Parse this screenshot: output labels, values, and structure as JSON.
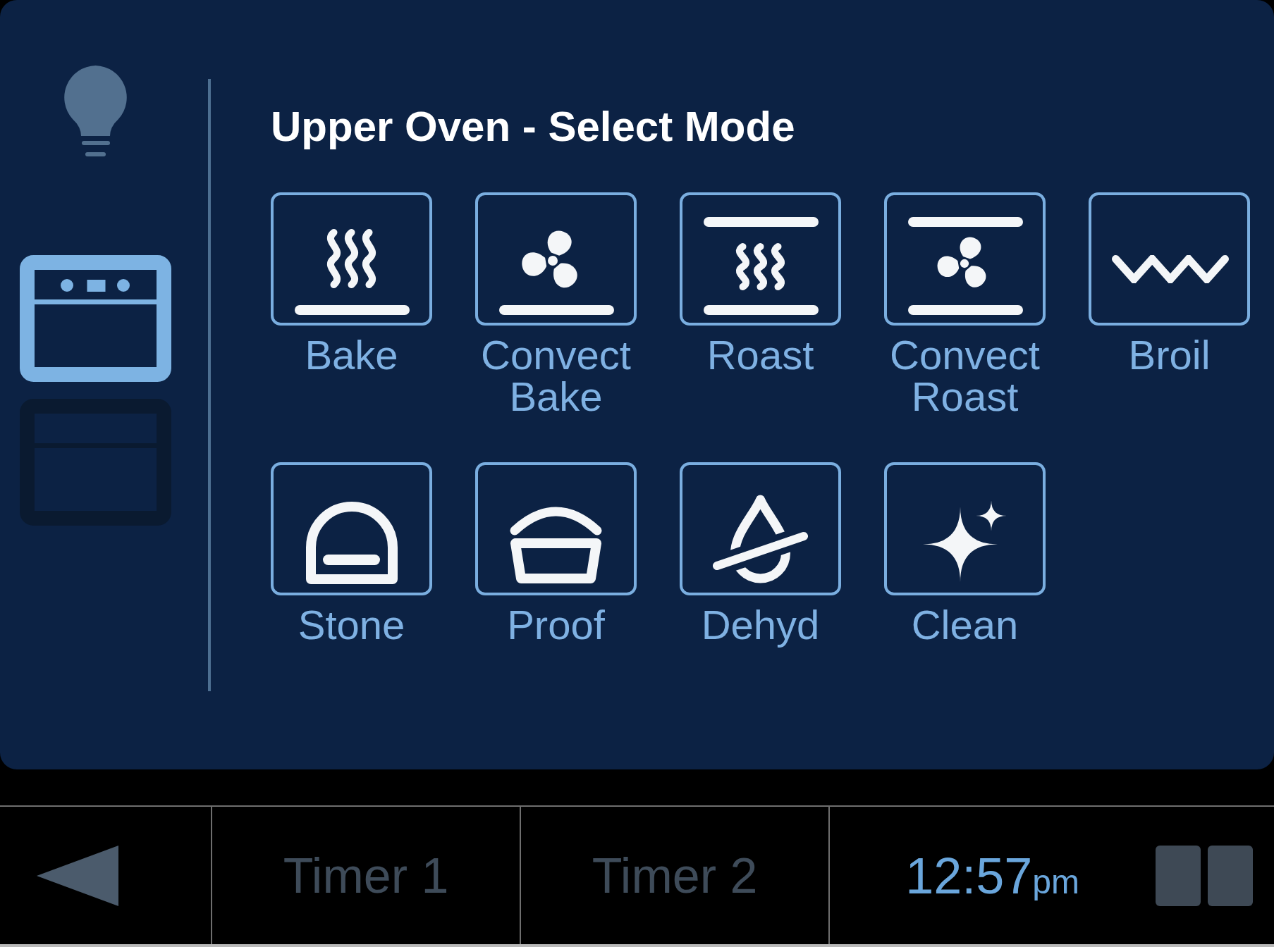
{
  "sidebar": {
    "ovens": [
      {
        "kind": "upper",
        "selected": true
      },
      {
        "kind": "lower",
        "selected": false
      }
    ]
  },
  "title": "Upper Oven - Select Mode",
  "modes": [
    {
      "label": "Bake",
      "kind": "bake"
    },
    {
      "label": "Convect Bake",
      "kind": "convect_bake"
    },
    {
      "label": "Roast",
      "kind": "roast"
    },
    {
      "label": "Convect Roast",
      "kind": "convect_roast"
    },
    {
      "label": "Broil",
      "kind": "broil"
    },
    {
      "label": "Stone",
      "kind": "stone"
    },
    {
      "label": "Proof",
      "kind": "proof"
    },
    {
      "label": "Dehyd",
      "kind": "dehyd"
    },
    {
      "label": "Clean",
      "kind": "clean"
    }
  ],
  "bottom_bar": {
    "timers": [
      {
        "label": "Timer 1"
      },
      {
        "label": "Timer 2"
      }
    ],
    "clock": {
      "time": "12:57",
      "period": "pm"
    }
  }
}
